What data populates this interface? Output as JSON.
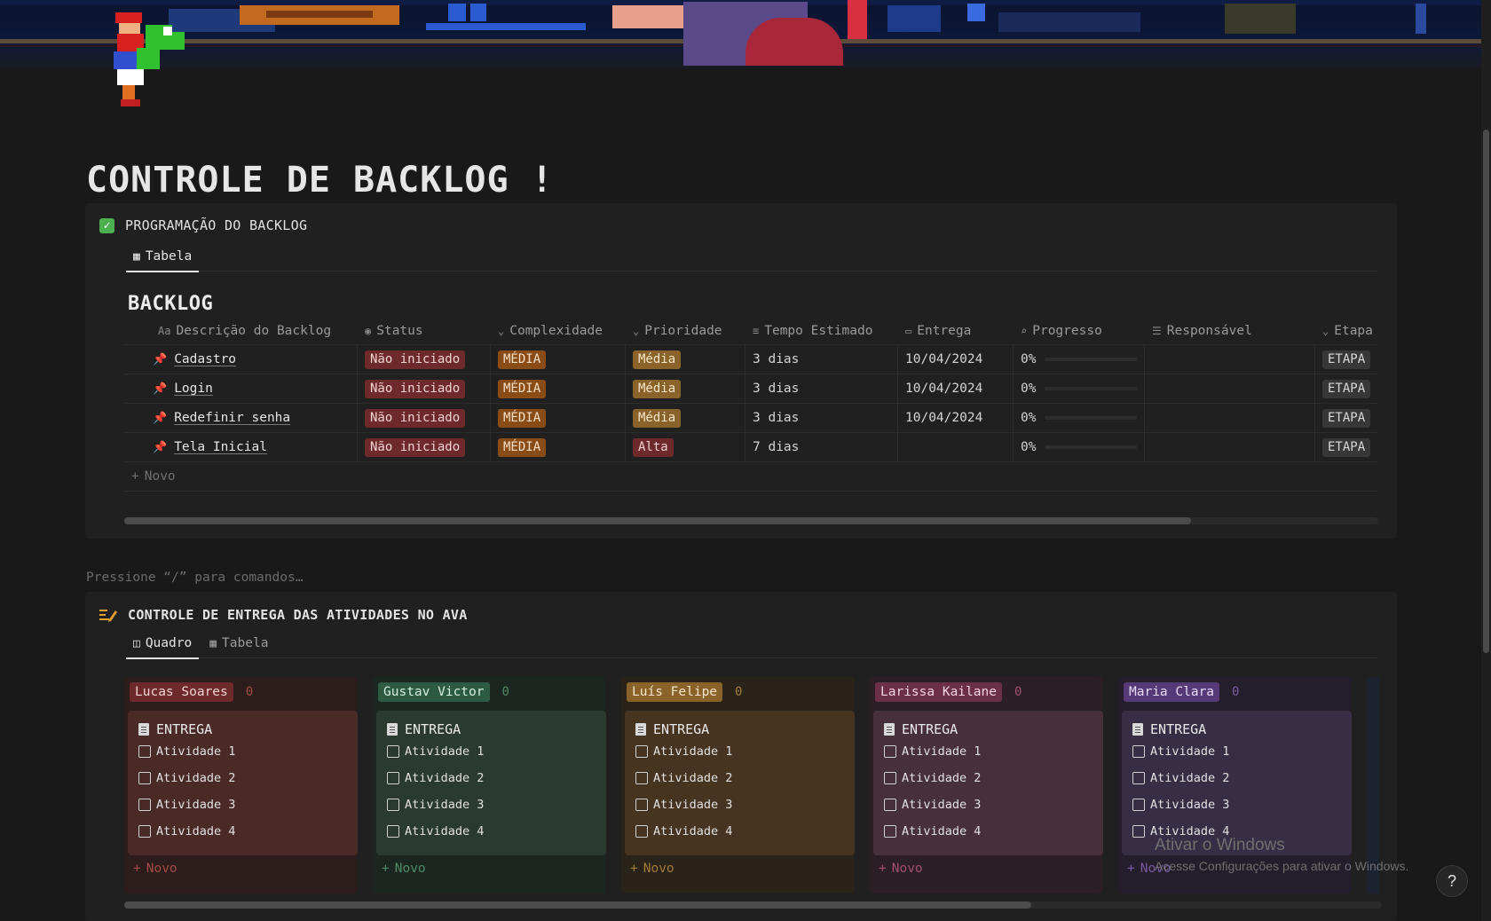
{
  "page": {
    "title": "CONTROLE DE BACKLOG !"
  },
  "backlog_db": {
    "title": "PROGRAMAÇÃO DO BACKLOG",
    "tabs": [
      {
        "label": "Tabela",
        "icon": "table-icon",
        "active": true
      }
    ],
    "table_title": "BACKLOG",
    "columns": [
      {
        "label": "Descrição do Backlog",
        "icon": "Aa"
      },
      {
        "label": "Status",
        "icon": "status-icon"
      },
      {
        "label": "Complexidade",
        "icon": "select-icon"
      },
      {
        "label": "Prioridade",
        "icon": "select-icon"
      },
      {
        "label": "Tempo Estimado",
        "icon": "text-icon"
      },
      {
        "label": "Entrega",
        "icon": "calendar-icon"
      },
      {
        "label": "Progresso",
        "icon": "search-icon"
      },
      {
        "label": "Responsável",
        "icon": "list-icon"
      },
      {
        "label": "Etapa",
        "icon": "select-icon"
      }
    ],
    "rows": [
      {
        "name": "Cadastro",
        "status": "Não iniciado",
        "complexidade": "MÉDIA",
        "prioridade": "Média",
        "prioridade_color": "brown",
        "tempo": "3 dias",
        "entrega": "10/04/2024",
        "progresso": "0%",
        "progress_fraction": 0,
        "responsavel": "",
        "etapa": "ETAPA"
      },
      {
        "name": "Login",
        "status": "Não iniciado",
        "complexidade": "MÉDIA",
        "prioridade": "Média",
        "prioridade_color": "brown",
        "tempo": "3 dias",
        "entrega": "10/04/2024",
        "progresso": "0%",
        "progress_fraction": 0,
        "responsavel": "",
        "etapa": "ETAPA"
      },
      {
        "name": "Redefinir senha",
        "status": "Não iniciado",
        "complexidade": "MÉDIA",
        "prioridade": "Média",
        "prioridade_color": "brown",
        "tempo": "3 dias",
        "entrega": "10/04/2024",
        "progresso": "0%",
        "progress_fraction": 0,
        "responsavel": "",
        "etapa": "ETAPA"
      },
      {
        "name": "Tela Inicial",
        "status": "Não iniciado",
        "complexidade": "MÉDIA",
        "prioridade": "Alta",
        "prioridade_color": "red",
        "tempo": "7 dias",
        "entrega": "",
        "progresso": "0%",
        "progress_fraction": 0,
        "responsavel": "",
        "etapa": "ETAPA"
      }
    ],
    "new_label": "Novo"
  },
  "editor_placeholder": "Pressione “/” para comandos…",
  "activities_db": {
    "title": "CONTROLE DE ENTREGA DAS ATIVIDADES NO AVA",
    "tabs": [
      {
        "label": "Quadro",
        "icon": "board-icon",
        "active": true
      },
      {
        "label": "Tabela",
        "icon": "table-icon",
        "active": false
      }
    ],
    "groups": [
      {
        "name": "Lucas Soares",
        "count": "0",
        "color": "red",
        "card": {
          "title": "ENTREGA",
          "todos": [
            "Atividade 1",
            "Atividade 2",
            "Atividade 3",
            "Atividade 4"
          ]
        },
        "new_label": "Novo"
      },
      {
        "name": "Gustav Victor",
        "count": "0",
        "color": "green",
        "card": {
          "title": "ENTREGA",
          "todos": [
            "Atividade 1",
            "Atividade 2",
            "Atividade 3",
            "Atividade 4"
          ]
        },
        "new_label": "Novo"
      },
      {
        "name": "Luís Felipe",
        "count": "0",
        "color": "brown",
        "card": {
          "title": "ENTREGA",
          "todos": [
            "Atividade 1",
            "Atividade 2",
            "Atividade 3",
            "Atividade 4"
          ]
        },
        "new_label": "Novo"
      },
      {
        "name": "Larissa Kailane",
        "count": "0",
        "color": "pink",
        "card": {
          "title": "ENTREGA",
          "todos": [
            "Atividade 1",
            "Atividade 2",
            "Atividade 3",
            "Atividade 4"
          ]
        },
        "new_label": "Novo"
      },
      {
        "name": "Maria Clara",
        "count": "0",
        "color": "purple",
        "card": {
          "title": "ENTREGA",
          "todos": [
            "Atividade 1",
            "Atividade 2",
            "Atividade 3",
            "Atividade 4"
          ]
        },
        "new_label": "Novo"
      }
    ]
  },
  "windows_watermark": {
    "line1": "Ativar o Windows",
    "line2": "Acesse Configurações para ativar o Windows."
  },
  "help_label": "?",
  "colors": {
    "background": "#191919",
    "block": "#202020",
    "tag_red": "#6e2a2a",
    "tag_orange": "#8a4c17",
    "tag_brown": "#89632a"
  }
}
